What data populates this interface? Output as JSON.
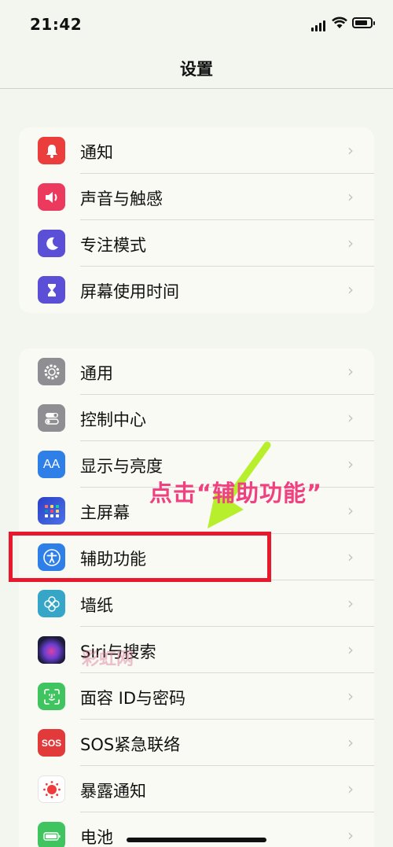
{
  "status": {
    "time": "21:42"
  },
  "nav": {
    "title": "设置"
  },
  "group1": [
    {
      "label": "通知",
      "icon": "bell-icon",
      "color": "#ec3d3d"
    },
    {
      "label": "声音与触感",
      "icon": "speaker-icon",
      "color": "#ec3a5e"
    },
    {
      "label": "专注模式",
      "icon": "moon-icon",
      "color": "#5a4fd6"
    },
    {
      "label": "屏幕使用时间",
      "icon": "hourglass-icon",
      "color": "#5a4fd6"
    }
  ],
  "group2": [
    {
      "label": "通用",
      "icon": "gear-icon",
      "color": "#8e8e93"
    },
    {
      "label": "控制中心",
      "icon": "toggles-icon",
      "color": "#8e8e93"
    },
    {
      "label": "显示与亮度",
      "icon": "text-size-icon",
      "color": "#2f7fe8",
      "glyph": "AA"
    },
    {
      "label": "主屏幕",
      "icon": "home-grid-icon",
      "color": "#2b50c8"
    },
    {
      "label": "辅助功能",
      "icon": "accessibility-icon",
      "color": "#2f7fe8"
    },
    {
      "label": "墙纸",
      "icon": "flower-icon",
      "color": "#36a6c8"
    },
    {
      "label": "Siri与搜索",
      "icon": "siri-icon",
      "color": "#1b1b3a"
    },
    {
      "label": "面容 ID与密码",
      "icon": "face-id-icon",
      "color": "#3fc460"
    },
    {
      "label": "SOS紧急联络",
      "icon": "sos-icon",
      "color": "#e23a3a",
      "glyph": "SOS"
    },
    {
      "label": "暴露通知",
      "icon": "exposure-icon",
      "color": "#ffffff"
    },
    {
      "label": "电池",
      "icon": "battery-icon",
      "color": "#3fc460"
    }
  ],
  "annotation": {
    "text": "点击“辅助功能”"
  },
  "watermark": {
    "text": "彩虹网"
  }
}
